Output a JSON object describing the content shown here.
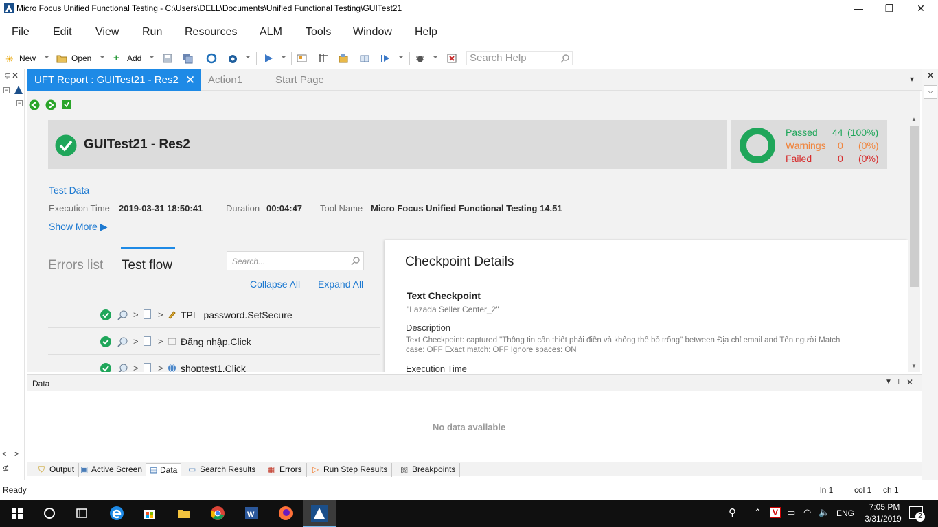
{
  "window": {
    "title": "Micro Focus Unified Functional Testing - C:\\Users\\DELL\\Documents\\Unified Functional Testing\\GUITest21",
    "minimize": "—",
    "restore": "❐",
    "close": "✕"
  },
  "menu": [
    "File",
    "Edit",
    "View",
    "Run",
    "Resources",
    "ALM",
    "Tools",
    "Window",
    "Help"
  ],
  "toolbar": {
    "new_label": "New",
    "open_label": "Open",
    "add_label": "Add",
    "search_placeholder": "Search Help"
  },
  "tabs": {
    "report": "UFT Report : GUITest21 - Res2",
    "action1": "Action1",
    "start_page": "Start Page",
    "close": "✕"
  },
  "report": {
    "title": "GUITest21 - Res2",
    "test_data_link": "Test Data",
    "execution_time_label": "Execution Time",
    "execution_time_value": "2019-03-31 18:50:41",
    "duration_label": "Duration",
    "duration_value": "00:04:47",
    "tool_name_label": "Tool Name",
    "tool_name_value": "Micro Focus Unified Functional Testing 14.51",
    "show_more": "Show More ▶",
    "summary": {
      "passed_label": "Passed",
      "passed_count": "44",
      "passed_pct": "(100%)",
      "warnings_label": "Warnings",
      "warnings_count": "0",
      "warnings_pct": "(0%)",
      "failed_label": "Failed",
      "failed_count": "0",
      "failed_pct": "(0%)",
      "passed_fraction": 1.0
    },
    "view_tabs": {
      "errors": "Errors list",
      "flow": "Test flow"
    },
    "search_placeholder": "Search...",
    "collapse_all": "Collapse All",
    "expand_all": "Expand All",
    "steps": [
      {
        "label": "TPL_password.SetSecure",
        "icon": "pencil-icon"
      },
      {
        "label": "Đăng nhập.Click",
        "icon": "button-icon"
      },
      {
        "label": "shoptest1.Click",
        "icon": "globe-icon"
      }
    ],
    "details": {
      "heading": "Checkpoint Details",
      "type": "Text Checkpoint",
      "name": "\"Lazada Seller Center_2\"",
      "description_label": "Description",
      "description_text": "Text Checkpoint: captured \"Thông tin cần thiết phải điền và không thể bỏ trống\" between Địa chỉ email and Tên người Match",
      "description_text2": "case: OFF Exact match: OFF Ignore spaces: ON",
      "exec_time_label": "Execution Time"
    }
  },
  "data_panel": {
    "title": "Data",
    "empty": "No data available"
  },
  "bottom_tabs": [
    "Output",
    "Active Screen",
    "Data",
    "Search Results",
    "Errors",
    "Run Step Results",
    "Breakpoints"
  ],
  "status": {
    "ready": "Ready",
    "ln": "ln 1",
    "col": "col 1",
    "ch": "ch 1"
  },
  "taskbar": {
    "time": "7:05 PM",
    "date": "3/31/2019",
    "lang": "ENG",
    "notifications": "2"
  },
  "colors": {
    "accent": "#1e8ae6",
    "passed": "#1fa65a",
    "warnings": "#f0843c",
    "failed": "#d62c2c",
    "link": "#1e7ad1"
  }
}
